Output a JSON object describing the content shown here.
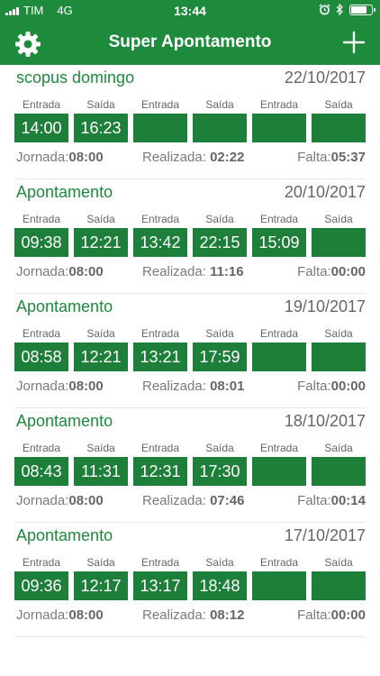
{
  "status_bar": {
    "carrier": "TIM",
    "network": "4G",
    "time": "13:44"
  },
  "nav": {
    "title": "Super Apontamento"
  },
  "slot_labels": [
    "Entrada",
    "Saída",
    "Entrada",
    "Saída",
    "Entrada",
    "Saída"
  ],
  "summary_labels": {
    "jornada": "Jornada:",
    "realizada": "Realizada:",
    "falta": "Falta:"
  },
  "days": [
    {
      "title": "scopus domingo",
      "date": "22/10/2017",
      "times": [
        "14:00",
        "16:23",
        "",
        "",
        "",
        ""
      ],
      "jornada": "08:00",
      "realizada": "02:22",
      "falta": "05:37"
    },
    {
      "title": "Apontamento",
      "date": "20/10/2017",
      "times": [
        "09:38",
        "12:21",
        "13:42",
        "22:15",
        "15:09",
        ""
      ],
      "jornada": "08:00",
      "realizada": "11:16",
      "falta": "00:00"
    },
    {
      "title": "Apontamento",
      "date": "19/10/2017",
      "times": [
        "08:58",
        "12:21",
        "13:21",
        "17:59",
        "",
        ""
      ],
      "jornada": "08:00",
      "realizada": "08:01",
      "falta": "00:00"
    },
    {
      "title": "Apontamento",
      "date": "18/10/2017",
      "times": [
        "08:43",
        "11:31",
        "12:31",
        "17:30",
        "",
        ""
      ],
      "jornada": "08:00",
      "realizada": "07:46",
      "falta": "00:14"
    },
    {
      "title": "Apontamento",
      "date": "17/10/2017",
      "times": [
        "09:36",
        "12:17",
        "13:17",
        "18:48",
        "",
        ""
      ],
      "jornada": "08:00",
      "realizada": "08:12",
      "falta": "00:00"
    }
  ],
  "battery_level": 0.85,
  "colors": {
    "brand_green": "#1e8a3b",
    "slot_green": "#1e7f3b",
    "title_green": "#1e8a3b",
    "text_gray": "#666666"
  },
  "icons": {
    "settings": "gear-icon",
    "add": "plus-icon",
    "alarm": "alarm-clock-icon",
    "bluetooth": "bluetooth-icon"
  }
}
